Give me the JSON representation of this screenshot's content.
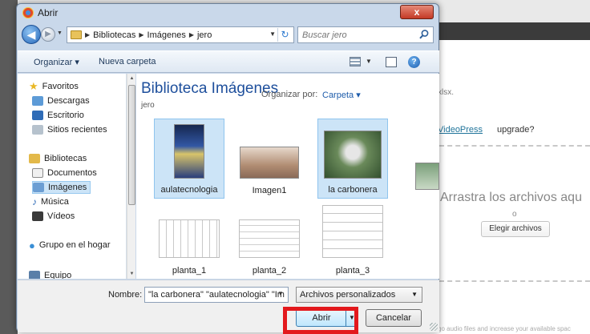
{
  "background": {
    "text_ext": "xlsx.",
    "upgrade_link": "VideoPress",
    "upgrade_rest": " upgrade?",
    "drop_text": "Arrastra los archivos aqu",
    "or_text": "o",
    "choose_button": "Elegir archivos",
    "footer_text": "go audio files and increase your available spac"
  },
  "dialog": {
    "title": "Abrir",
    "close_label": "x",
    "breadcrumbs": [
      "Bibliotecas",
      "Imágenes",
      "jero"
    ],
    "search_placeholder": "Buscar jero",
    "toolbar": {
      "organize": "Organizar ▾",
      "new_folder": "Nueva carpeta"
    },
    "nav": {
      "favorites": "Favoritos",
      "downloads": "Descargas",
      "desktop": "Escritorio",
      "recent": "Sitios recientes",
      "libraries": "Bibliotecas",
      "documents": "Documentos",
      "images": "Imágenes",
      "music": "Música",
      "videos": "Vídeos",
      "homegroup": "Grupo en el hogar",
      "computer": "Equipo"
    },
    "library": {
      "title": "Biblioteca Imágenes",
      "subtitle": "jero",
      "arrange_label": "Organizar por:",
      "arrange_value": "Carpeta ▾"
    },
    "files": [
      {
        "name": "aulatecnologia",
        "selected": true
      },
      {
        "name": "Imagen1",
        "selected": false
      },
      {
        "name": "la carbonera",
        "selected": true
      },
      {
        "name": "planta_1",
        "selected": false
      },
      {
        "name": "planta_2",
        "selected": false
      },
      {
        "name": "planta_3",
        "selected": false
      }
    ],
    "filename_label": "Nombre:",
    "filename_value": "\"la carbonera\" \"aulatecnologia\" \"Im",
    "filetype_value": "Archivos personalizados",
    "open_button": "Abrir",
    "cancel_button": "Cancelar"
  },
  "colors": {
    "highlight": "#e3191d",
    "selection": "#cce4f7",
    "library_title": "#1e4f9c"
  }
}
